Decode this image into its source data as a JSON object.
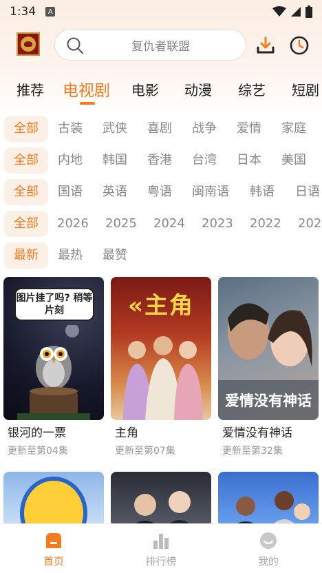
{
  "status": {
    "time": "1:34",
    "notif": "A"
  },
  "header": {
    "search_placeholder": "复仇者联盟"
  },
  "categories": [
    {
      "label": "推荐",
      "active": false
    },
    {
      "label": "电视剧",
      "active": true
    },
    {
      "label": "电影",
      "active": false
    },
    {
      "label": "动漫",
      "active": false
    },
    {
      "label": "综艺",
      "active": false
    },
    {
      "label": "短剧",
      "active": false
    }
  ],
  "filters": {
    "genre": [
      "全部",
      "古装",
      "武侠",
      "喜剧",
      "战争",
      "爱情",
      "家庭"
    ],
    "region": [
      "全部",
      "内地",
      "韩国",
      "香港",
      "台湾",
      "日本",
      "美国"
    ],
    "language": [
      "全部",
      "国语",
      "英语",
      "粤语",
      "闽南语",
      "韩语",
      "日语"
    ],
    "year": [
      "全部",
      "2026",
      "2025",
      "2024",
      "2023",
      "2022",
      "202"
    ],
    "sort": [
      "最新",
      "最热",
      "最赞"
    ]
  },
  "posters": {
    "p1_bubble": "图片挂了吗? 稍等片刻",
    "p2_title": "«主角",
    "p3_caption": "爱情没有神话"
  },
  "cards": [
    {
      "title": "银河的一票",
      "subtitle": "更新至第04集"
    },
    {
      "title": "主角",
      "subtitle": "更新至第07集"
    },
    {
      "title": "爱情没有神话",
      "subtitle": "更新至第32集"
    }
  ],
  "tabbar": [
    {
      "label": "首页",
      "icon": "home-icon",
      "active": true
    },
    {
      "label": "排行榜",
      "icon": "chart-icon",
      "active": false
    },
    {
      "label": "我的",
      "icon": "profile-icon",
      "active": false
    }
  ],
  "colors": {
    "accent": "#f47b20",
    "chip_bg": "#fbefe6"
  }
}
